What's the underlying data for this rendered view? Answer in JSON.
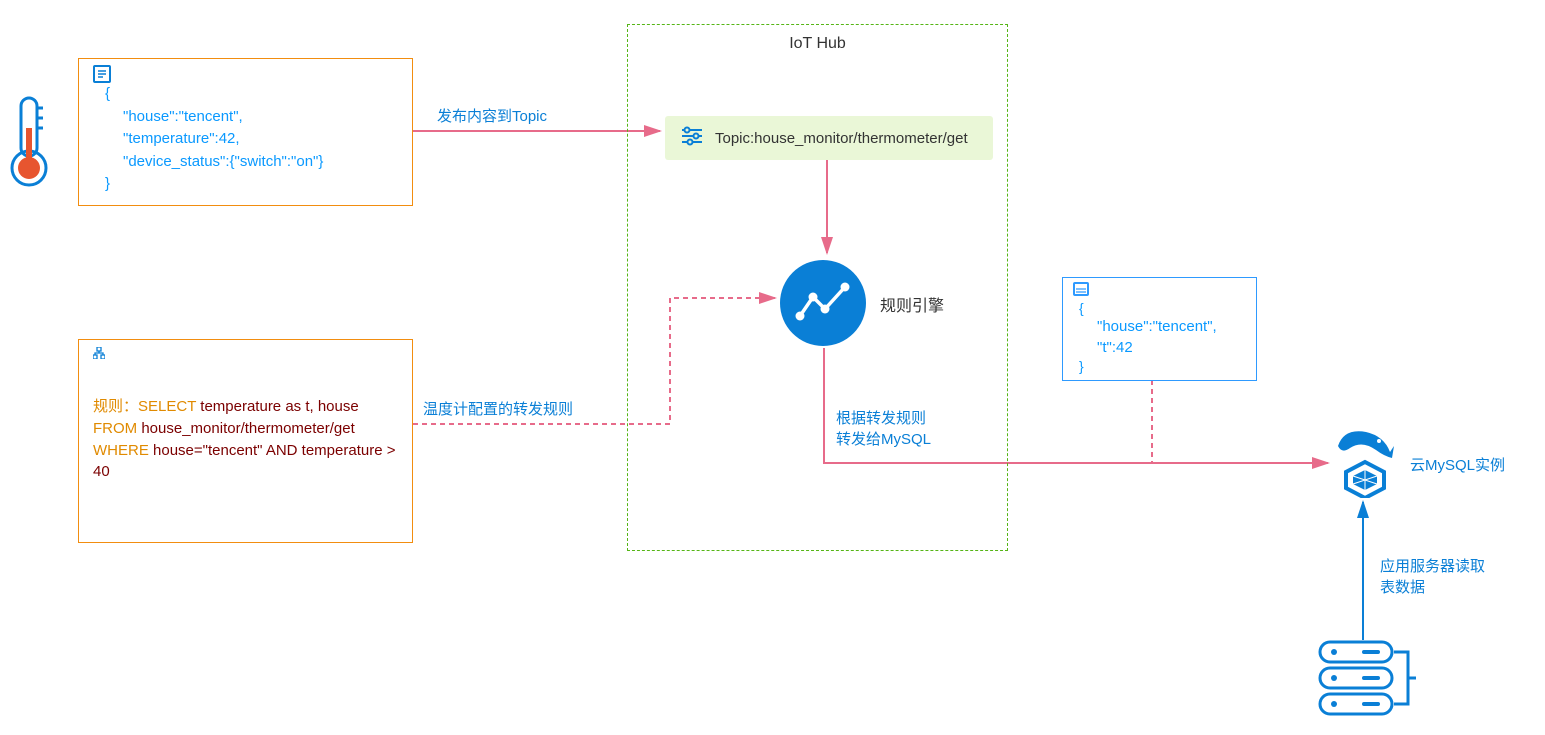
{
  "hub_title": "IoT Hub",
  "device_json": {
    "lines": [
      "\"house\":\"tencent\",",
      "\"temperature\":42,",
      "\"device_status\":{\"switch\":\"on\"}"
    ]
  },
  "rule": {
    "prefix": "规则：",
    "select_kw": "SELECT",
    "select_rest": " temperature as t, house",
    "from_kw": "FROM",
    "from_rest": " house_monitor/thermometer/get",
    "where_kw": "WHERE",
    "where_rest": " house=\"tencent\" AND temperature > 40"
  },
  "topic": "Topic:house_monitor/thermometer/get",
  "rule_engine_label": "规则引擎",
  "arrow_publish": "发布内容到Topic",
  "arrow_rule_config": "温度计配置的转发规则",
  "arrow_forward": "根据转发规则\n转发给MySQL",
  "out_json": {
    "lines": [
      "\"house\":\"tencent\",",
      "\"t\":42"
    ]
  },
  "mysql_label": "云MySQL实例",
  "server_label": "应用服务器读取\n表数据"
}
